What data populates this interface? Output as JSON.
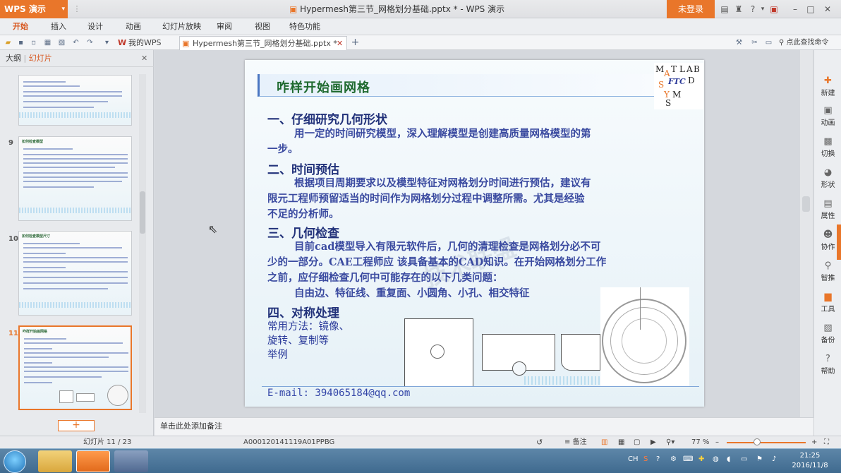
{
  "app": {
    "name": "WPS 演示",
    "window_title": "Hypermesh第三节_网格划分基础.pptx * - WPS 演示",
    "login_label": "未登录"
  },
  "menu": [
    "开始",
    "插入",
    "设计",
    "动画",
    "幻灯片放映",
    "审阅",
    "视图",
    "特色功能"
  ],
  "tabs": {
    "wps": "我的WPS",
    "doc": "Hypermesh第三节_网格划分基础.pptx *",
    "search": "点此查找命令"
  },
  "left_panel": {
    "outline": "大纲",
    "slides": "幻灯片",
    "slide_numbers": [
      "9",
      "10",
      "11"
    ],
    "thumb_titles": [
      "如何检查模型",
      "如何检查模型尺寸",
      "咋样开始画网格"
    ],
    "add": "+"
  },
  "slide": {
    "title": "咋样开始画网格",
    "s1_head": "一、仔细研究几何形状",
    "s1_l1": "用一定的时间研究模型，深入理解模型是创建高质量网格模型的第",
    "s1_l2": "一步。",
    "s2_head": "二、时间预估",
    "s2_l1": "根据项目周期要求以及模型特征对网格划分时间进行预估，建议有",
    "s2_l2": "限元工程师预留适当的时间作为网格划分过程中调整所需。尤其是经验",
    "s2_l3": "不足的分析师。",
    "s3_head": "三、几何检查",
    "s3_l1": "目前cad模型导入有限元软件后，几何的清理检查是网格划分必不可",
    "s3_l2": "少的一部分。CAE工程师应 该具备基本的CAD知识。在开始网格划分工作",
    "s3_l3": "之前，应仔细检查几何中可能存在的以下几类问题：",
    "s3_l4": "自由边、特征线、重复面、小圆角、小孔、相交特征",
    "s4_head": "四、对称处理",
    "s4_l1": "常用方法：镜像、",
    "s4_l2": "旋转、复制等",
    "s4_l3": "举例",
    "email": "E-mail: 394065184@qq.com",
    "logo_letters": [
      "M",
      "A",
      "T",
      "L",
      "A",
      "B",
      "FTC",
      "S",
      "Y",
      "M",
      "S",
      "D"
    ],
    "watermark": "技术联盟"
  },
  "right_bar": [
    "新建",
    "动画",
    "切换",
    "形状",
    "属性",
    "协作",
    "智推",
    "工具",
    "备份",
    "帮助"
  ],
  "notes": "单击此处添加备注",
  "status": {
    "slide": "幻灯片 11 / 23",
    "code": "A000120141119A01PPBG",
    "notes": "备注",
    "zoom": "77 %"
  },
  "taskbar": {
    "time": "21:25",
    "date": "2016/11/8",
    "lang": "CH"
  },
  "colors": {
    "accent": "#e9762a",
    "title_green": "#1f6a2f",
    "heading_blue": "#22327a"
  }
}
